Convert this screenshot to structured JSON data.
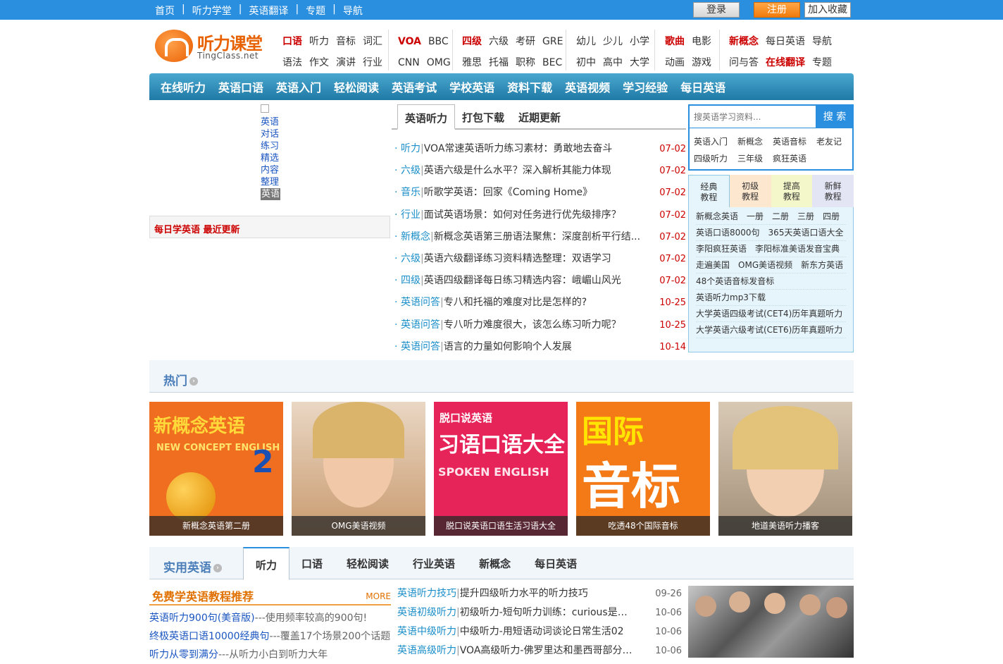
{
  "topnav": {
    "items": [
      "首页",
      "听力学堂",
      "英语翻译",
      "专题",
      "导航"
    ],
    "sep": "|",
    "login": "登录",
    "register": "注册",
    "favorite": "加入收藏"
  },
  "logo": {
    "title": "听力课堂",
    "sub": "TingClass.net"
  },
  "linkgroups": {
    "g1": {
      "r1": [
        "口语",
        "听力",
        "音标",
        "词汇"
      ],
      "r2": [
        "语法",
        "作文",
        "演讲",
        "行业"
      ]
    },
    "g2": {
      "r1": [
        "VOA",
        "BBC"
      ],
      "r2": [
        "CNN",
        "OMG"
      ]
    },
    "g3": {
      "r1": [
        "四级",
        "六级",
        "考研",
        "GRE"
      ],
      "r2": [
        "雅思",
        "托福",
        "职称",
        "BEC"
      ]
    },
    "g4": {
      "r1": [
        "幼儿",
        "少儿",
        "小学"
      ],
      "r2": [
        "初中",
        "高中",
        "大学"
      ]
    },
    "g5": {
      "r1": [
        "歌曲",
        "电影"
      ],
      "r2": [
        "动画",
        "游戏"
      ]
    },
    "g6": {
      "r1": [
        "新概念",
        "每日英语",
        "导航"
      ],
      "r2": [
        "问与答",
        "在线翻译",
        "专题"
      ]
    }
  },
  "mainnav": [
    "在线听力",
    "英语口语",
    "英语入门",
    "轻松阅读",
    "英语考试",
    "学校英语",
    "资料下载",
    "英语视频",
    "学习经验",
    "每日英语"
  ],
  "ad": {
    "alt": "英语对话练习精选内容整理",
    "overlay": "英语"
  },
  "daily": {
    "label": "每日学英语 最近更新"
  },
  "tabs": [
    "英语听力",
    "打包下载",
    "近期更新"
  ],
  "news": [
    {
      "cat": "听力",
      "title": "VOA常速英语听力练习素材：勇敢地去奋斗",
      "date": "07-02"
    },
    {
      "cat": "六级",
      "title": "英语六级是什么水平？深入解析其能力体现",
      "date": "07-02"
    },
    {
      "cat": "音乐",
      "title": "听歌学英语：回家《Coming Home》",
      "date": "07-02"
    },
    {
      "cat": "行业",
      "title": "面试英语场景：如何对任务进行优先级排序？",
      "date": "07-02"
    },
    {
      "cat": "新概念",
      "title": "新概念英语第三册语法聚焦：深度剖析平行结...",
      "date": "07-02"
    },
    {
      "cat": "六级",
      "title": "英语六级翻译练习资料精选整理：双语学习",
      "date": "07-02"
    },
    {
      "cat": "四级",
      "title": "英语四级翻译每日练习精选内容：峨嵋山风光",
      "date": "07-02"
    },
    {
      "cat": "英语问答",
      "title": "专八和托福的难度对比是怎样的?",
      "date": "10-25"
    },
    {
      "cat": "英语问答",
      "title": "专八听力难度很大，该怎么练习听力呢？",
      "date": "10-25"
    },
    {
      "cat": "英语问答",
      "title": "语言的力量如何影响个人发展",
      "date": "10-14"
    }
  ],
  "search": {
    "placeholder": "搜英语学习资料...",
    "button": "搜 索",
    "kw1": [
      "英语入门",
      "新概念",
      "英语音标",
      "老友记"
    ],
    "kw2": [
      "四级听力",
      "三年级",
      "疯狂英语"
    ]
  },
  "ctabs": [
    {
      "l1": "经典",
      "l2": "教程",
      "bg": "#e6f4fb"
    },
    {
      "l1": "初级",
      "l2": "教程",
      "bg": "#fde7cf"
    },
    {
      "l1": "提高",
      "l2": "教程",
      "bg": "#f4f7c9"
    },
    {
      "l1": "新鲜",
      "l2": "教程",
      "bg": "#e3e5f5"
    }
  ],
  "clist": [
    [
      "新概念英语",
      "一册",
      "二册",
      "三册",
      "四册"
    ],
    [
      "英语口语8000句",
      "365天英语口语大全"
    ],
    [
      "李阳疯狂英语",
      "李阳标准美语发音宝典"
    ],
    [
      "走遍美国",
      "OMG美语视频",
      "新东方英语"
    ],
    [
      "48个英语音标发音标"
    ],
    [
      "英语听力mp3下载"
    ],
    [
      "大学英语四级考试(CET4)历年真题听力"
    ],
    [
      "大学英语六级考试(CET6)历年真题听力"
    ]
  ],
  "hot": {
    "title": "热门",
    "items": [
      {
        "cap": "新概念英语第二册",
        "t1": "新概念英语",
        "t2": "NEW CONCEPT ENGLISH",
        "t3": "2",
        "bg": "#f06e1f"
      },
      {
        "cap": "OMG美语视频",
        "bg": "#d9b48e"
      },
      {
        "cap": "脱口说英语口语生活习语大全",
        "t1": "脱口说英语",
        "t2": "习语口语大全",
        "t3": "SPOKEN ENGLISH",
        "bg": "#e6245a"
      },
      {
        "cap": "吃透48个国际音标",
        "t1": "国际",
        "t2": "音标",
        "bg": "#f37a16"
      },
      {
        "cap": "地道美语听力播客",
        "bg": "#c9b49b"
      }
    ]
  },
  "practical": {
    "title": "实用英语",
    "tabs": [
      "听力",
      "口语",
      "轻松阅读",
      "行业英语",
      "新概念",
      "每日英语"
    ]
  },
  "free": {
    "title": "免费学英语教程推荐",
    "more": "MORE",
    "items": [
      {
        "l": "英语听力900句(美音版)",
        "s": "---使用频率较高的900句!"
      },
      {
        "l": "终极英语口语10000经典句",
        "s": "---覆盖17个场景200个话题"
      },
      {
        "l": "听力从零到满分",
        "s": "---从听力小白到听力大年"
      }
    ]
  },
  "plist": [
    {
      "cat": "英语听力技巧",
      "title": "提升四级听力水平的听力技巧",
      "date": "09-26"
    },
    {
      "cat": "英语初级听力",
      "title": "初级听力-短句听力训练：curious是什...",
      "date": "10-06"
    },
    {
      "cat": "英语中级听力",
      "title": "中级听力-用短语动词谈论日常生活02",
      "date": "10-06"
    },
    {
      "cat": "英语高级听力",
      "title": "VOA高级听力-佛罗里达和墨西哥部分地...",
      "date": "10-06"
    }
  ]
}
